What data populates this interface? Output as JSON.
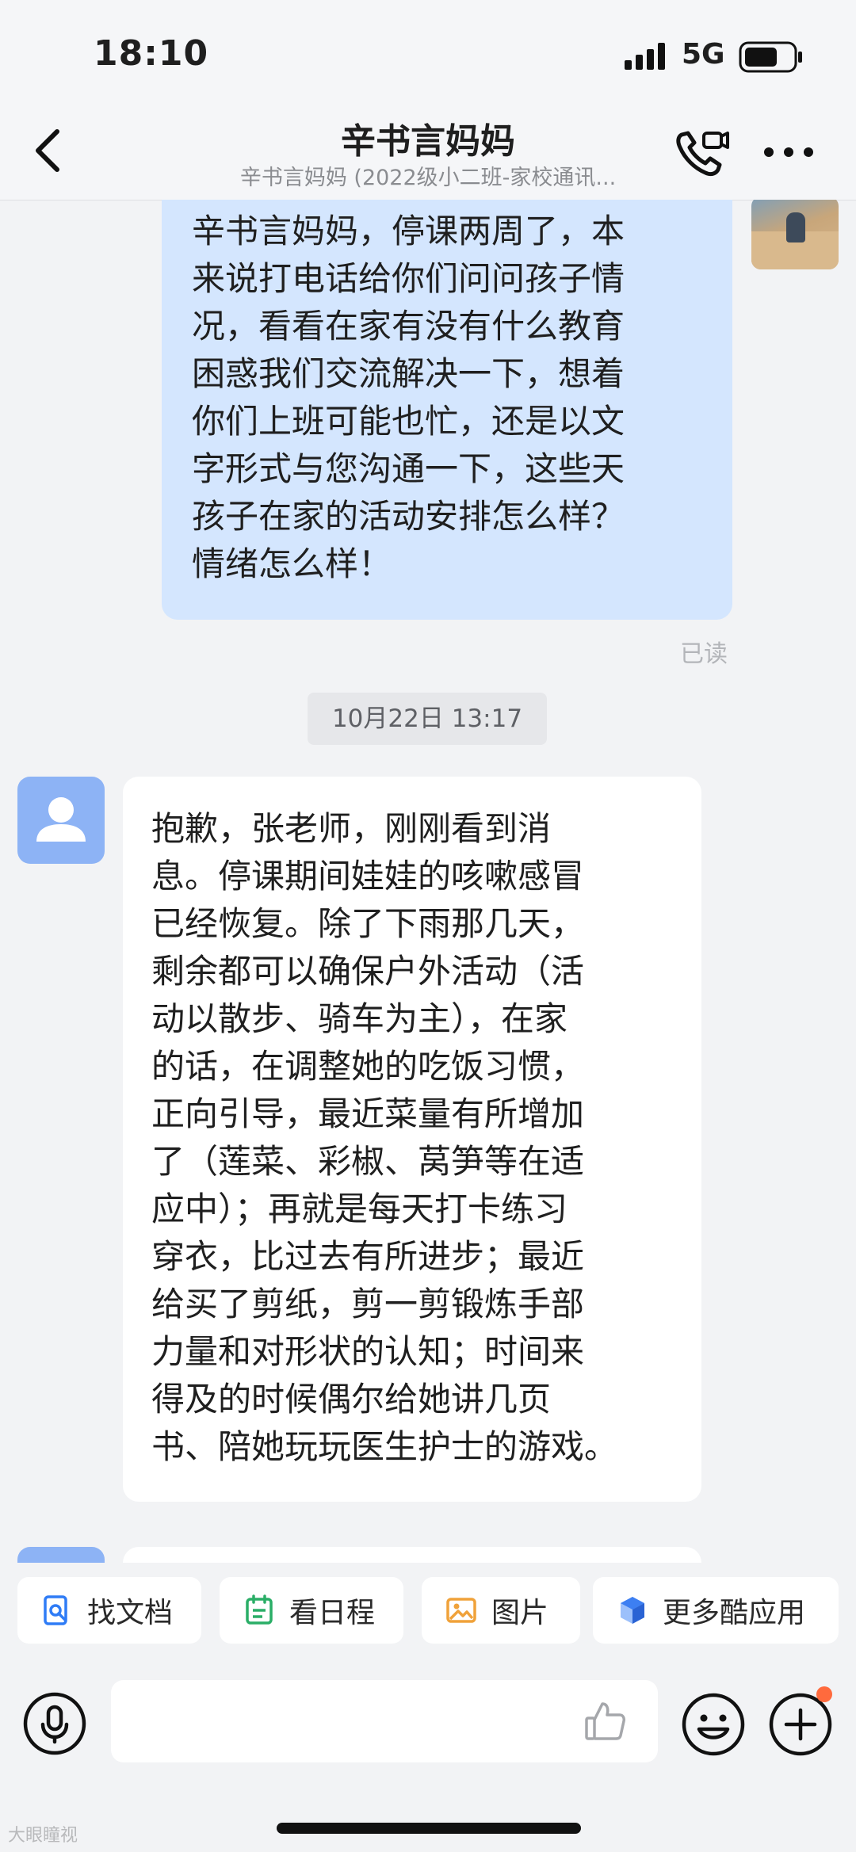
{
  "status_bar": {
    "time": "18:10",
    "network": "5G"
  },
  "header": {
    "title": "辛书言妈妈",
    "subtitle": "辛书言妈妈 (2022级小二班-家校通讯..."
  },
  "messages": {
    "outgoing": {
      "lines": [
        "辛书言妈妈，停课两周了，本",
        "来说打电话给你们问问孩子情",
        "况，看看在家有没有什么教育",
        "困惑我们交流解决一下，想着",
        "你们上班可能也忙，还是以文",
        "字形式与您沟通一下，这些天",
        "孩子在家的活动安排怎么样？",
        "情绪怎么样！"
      ],
      "status": "已读"
    },
    "timestamp": "10月22日 13:17",
    "incoming": {
      "lines": [
        "抱歉，张老师，刚刚看到消",
        "息。停课期间娃娃的咳嗽感冒",
        "已经恢复。除了下雨那几天，",
        "剩余都可以确保户外活动（活",
        "动以散步、骑车为主），在家",
        "的话，在调整她的吃饭习惯，",
        "正向引导，最近菜量有所增加",
        "了（莲菜、彩椒、莴笋等在适",
        "应中）；再就是每天打卡练习",
        "穿衣，比过去有所进步；最近",
        "给买了剪纸，剪一剪锻炼手部",
        "力量和对形状的认知；时间来",
        "得及的时候偶尔给她讲几页",
        "书、陪她玩玩医生护士的游戏。"
      ]
    }
  },
  "shortcuts": [
    {
      "label": "找文档",
      "icon": "doc-search-icon",
      "color": "#2f7cf6"
    },
    {
      "label": "看日程",
      "icon": "calendar-icon",
      "color": "#2aae67"
    },
    {
      "label": "图片",
      "icon": "image-icon",
      "color": "#f0a23a"
    },
    {
      "label": "更多酷应用",
      "icon": "apps-cube-icon",
      "color": "#3d7ff2"
    }
  ],
  "watermark": "大眼瞳视"
}
